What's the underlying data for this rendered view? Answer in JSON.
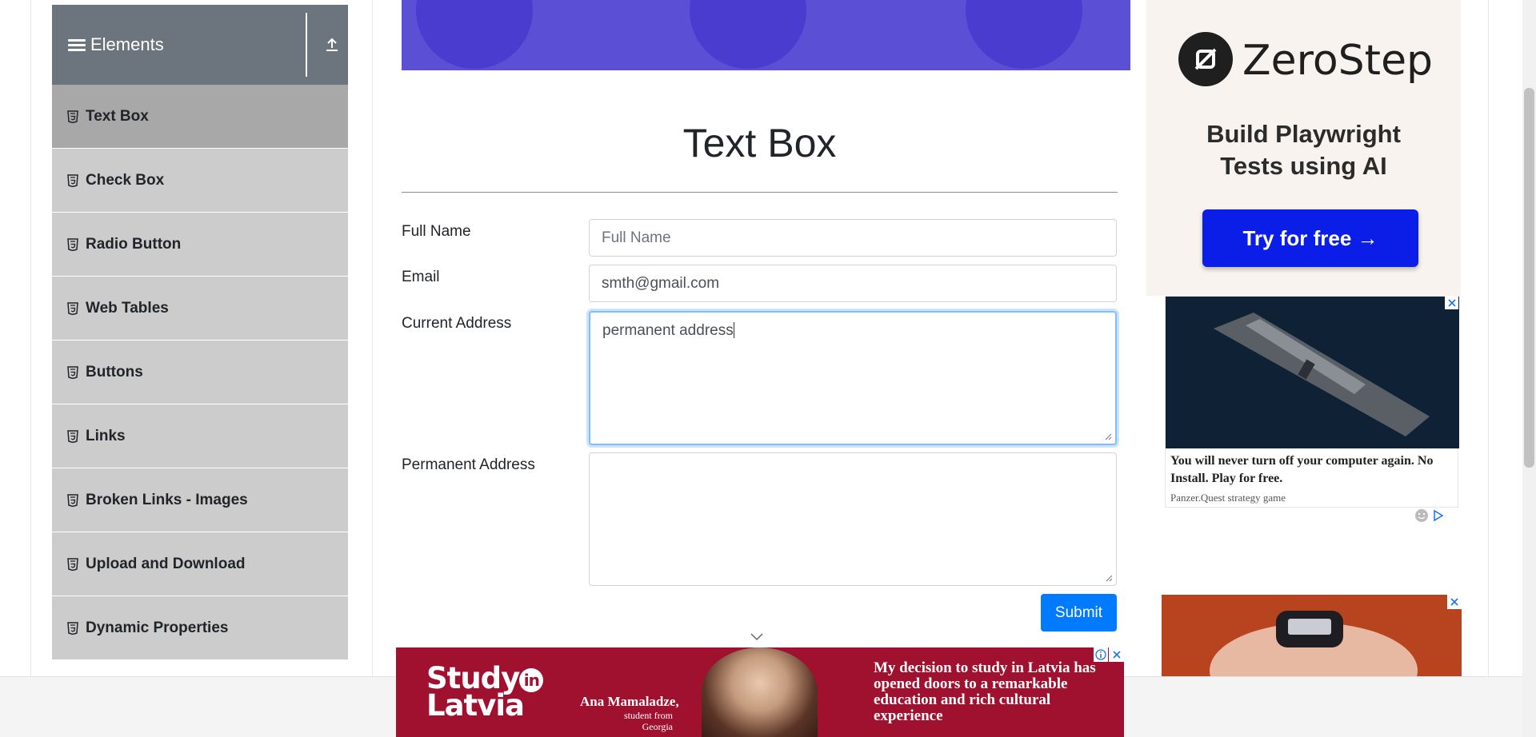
{
  "sidebar": {
    "group_title": "Elements",
    "items": [
      {
        "label": "Text Box",
        "active": true
      },
      {
        "label": "Check Box"
      },
      {
        "label": "Radio Button"
      },
      {
        "label": "Web Tables"
      },
      {
        "label": "Buttons"
      },
      {
        "label": "Links"
      },
      {
        "label": "Broken Links - Images"
      },
      {
        "label": "Upload and Download"
      },
      {
        "label": "Dynamic Properties"
      }
    ]
  },
  "main": {
    "title": "Text Box",
    "form": {
      "full_name": {
        "label": "Full Name",
        "placeholder": "Full Name",
        "value": ""
      },
      "email": {
        "label": "Email",
        "value": "smth@gmail.com"
      },
      "current_address": {
        "label": "Current Address",
        "value": "permanent address"
      },
      "permanent_address": {
        "label": "Permanent Address",
        "value": ""
      },
      "submit_label": "Submit"
    }
  },
  "ads": {
    "zerostep": {
      "brand": "ZeroStep",
      "tagline_line1": "Build Playwright",
      "tagline_line2": "Tests using AI",
      "cta": "Try for free →"
    },
    "panzer": {
      "text": "You will never turn off your computer again. No Install. Play for free.",
      "source": "Panzer.Quest strategy game"
    },
    "latvia": {
      "logo_line1": "Study",
      "logo_in": "in",
      "logo_line2": "Latvia",
      "person_name": "Ana Mamaladze,",
      "person_role": "student from Georgia",
      "quote": "My decision to study in Latvia has opened doors to a remarkable education and rich cultural experience"
    }
  },
  "colors": {
    "sidebar_header": "#6c757d",
    "sidebar_item": "#cccccc",
    "sidebar_item_active": "#a8a8a8",
    "primary_button": "#007bff",
    "focus_border": "#80bdff",
    "banner": "#5b4fd6",
    "zerostep_cta": "#0a1ee8",
    "latvia_ad": "#a0102f"
  },
  "icons": {
    "menu": "hamburger-icon",
    "collapse": "upload-arrow-icon",
    "item": "html5-icon",
    "scroll_down": "chevron-down-icon",
    "close": "close-icon",
    "info": "info-icon"
  }
}
